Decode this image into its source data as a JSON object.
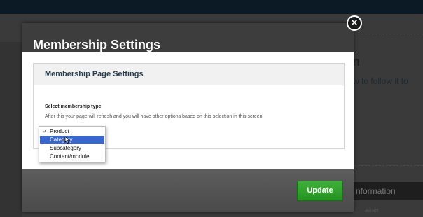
{
  "background": {
    "heading_fragment": "n",
    "text_fragment": "w to follow it to",
    "panel_label": "nformation",
    "small_text": "ainer"
  },
  "modal": {
    "title": "Membership Settings",
    "close_label": "×",
    "section_title": "Membership Page Settings",
    "field_label": "Select membership type",
    "help_text": "After this your page will refresh and you will have other options based on this selection in this screen.",
    "membership_type": {
      "selected_value": "Product",
      "highlighted_option": "Category",
      "options": [
        "Product",
        "Category",
        "Subcategory",
        "Content/module"
      ]
    },
    "update_label": "Update"
  },
  "colors": {
    "update_button": "#2aa12a",
    "highlight": "#3a66cf",
    "section_title": "#2a3d4d"
  }
}
